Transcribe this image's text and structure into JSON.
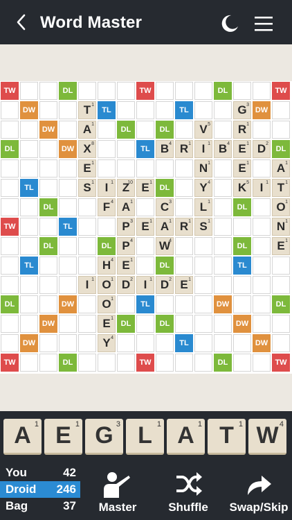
{
  "header": {
    "title": "Word Master",
    "back_icon": "chevron-left-icon",
    "night_icon": "moon-icon",
    "menu_icon": "hamburger-menu-icon"
  },
  "board": {
    "size": 15,
    "premium_labels": {
      "TW": "TW",
      "DW": "DW",
      "TL": "TL",
      "DL": "DL"
    },
    "colors": {
      "TW": "#de4c4c",
      "DW": "#e0913e",
      "TL": "#2a8ad0",
      "DL": "#7db93b",
      "tile": "#e8dfcd"
    },
    "premiums": [
      "TW..DL...TW...DL..TW",
      "x"
    ],
    "premium_grid": [
      [
        "TW",
        "",
        "",
        "DL",
        "",
        "",
        "",
        "TW",
        "",
        "",
        "",
        "DL",
        "",
        "",
        "TW"
      ],
      [
        "",
        "DW",
        "",
        "",
        "",
        "TL",
        "",
        "",
        "",
        "TL",
        "",
        "",
        "",
        "DW",
        ""
      ],
      [
        "",
        "",
        "DW",
        "",
        "",
        "",
        "DL",
        "",
        "DL",
        "",
        "",
        "",
        "DW",
        "",
        ""
      ],
      [
        "DL",
        "",
        "",
        "DW",
        "",
        "",
        "",
        "TL",
        "",
        "",
        "",
        "DW",
        "",
        "",
        "DL"
      ],
      [
        "",
        "",
        "",
        "",
        "DW",
        "",
        "",
        "",
        "",
        "",
        "DW",
        "",
        "",
        "",
        ""
      ],
      [
        "",
        "TL",
        "",
        "",
        "",
        "TL",
        "",
        "",
        "DL",
        "",
        "",
        "",
        "TL",
        "",
        ""
      ],
      [
        "",
        "",
        "DL",
        "",
        "",
        "",
        "DL",
        "",
        "DL",
        "",
        "",
        "",
        "DL",
        "",
        ""
      ],
      [
        "TW",
        "",
        "",
        "TL",
        "",
        "",
        "",
        "",
        "",
        "",
        "TL",
        "",
        "",
        "",
        "TW"
      ],
      [
        "",
        "",
        "DL",
        "",
        "",
        "DL",
        "",
        "",
        "DL",
        "",
        "",
        "",
        "DL",
        "",
        ""
      ],
      [
        "",
        "TL",
        "",
        "",
        "",
        "TL",
        "",
        "",
        "DL",
        "",
        "",
        "",
        "TL",
        "",
        ""
      ],
      [
        "",
        "",
        "",
        "",
        "DW",
        "",
        "",
        "",
        "",
        "DW",
        "",
        "",
        "",
        "",
        ""
      ],
      [
        "DL",
        "",
        "",
        "DW",
        "",
        "",
        "",
        "TL",
        "",
        "",
        "",
        "DW",
        "",
        "",
        "DL"
      ],
      [
        "",
        "",
        "DW",
        "",
        "",
        "",
        "DL",
        "",
        "DL",
        "",
        "",
        "",
        "DW",
        "",
        ""
      ],
      [
        "",
        "DW",
        "",
        "",
        "",
        "",
        "",
        "",
        "",
        "TL",
        "",
        "",
        "",
        "DW",
        ""
      ],
      [
        "TW",
        "",
        "",
        "DL",
        "",
        "",
        "",
        "TW",
        "",
        "",
        "",
        "DL",
        "",
        "",
        "TW"
      ]
    ],
    "tiles": [
      {
        "r": 1,
        "c": 4,
        "letter": "T",
        "points": "1"
      },
      {
        "r": 1,
        "c": 12,
        "letter": "G",
        "points": "3"
      },
      {
        "r": 2,
        "c": 4,
        "letter": "A",
        "points": "1"
      },
      {
        "r": 2,
        "c": 10,
        "letter": "V",
        "points": "5"
      },
      {
        "r": 2,
        "c": 12,
        "letter": "R",
        "points": "1"
      },
      {
        "r": 3,
        "c": 4,
        "letter": "X",
        "points": "8"
      },
      {
        "r": 3,
        "c": 8,
        "letter": "B",
        "points": "4"
      },
      {
        "r": 3,
        "c": 9,
        "letter": "R",
        "points": "1"
      },
      {
        "r": 3,
        "c": 10,
        "letter": "I",
        "points": "1"
      },
      {
        "r": 3,
        "c": 11,
        "letter": "B",
        "points": "4"
      },
      {
        "r": 3,
        "c": 12,
        "letter": "E",
        "points": "1"
      },
      {
        "r": 3,
        "c": 13,
        "letter": "D",
        "points": "2"
      },
      {
        "r": 4,
        "c": 4,
        "letter": "E",
        "points": "1"
      },
      {
        "r": 4,
        "c": 10,
        "letter": "N",
        "points": "1"
      },
      {
        "r": 4,
        "c": 12,
        "letter": "E",
        "points": "1"
      },
      {
        "r": 4,
        "c": 14,
        "letter": "A",
        "points": "1"
      },
      {
        "r": 5,
        "c": 4,
        "letter": "S",
        "points": "1"
      },
      {
        "r": 5,
        "c": 5,
        "letter": "I",
        "points": "1"
      },
      {
        "r": 5,
        "c": 6,
        "letter": "Z",
        "points": "10"
      },
      {
        "r": 5,
        "c": 7,
        "letter": "E",
        "points": "1"
      },
      {
        "r": 5,
        "c": 10,
        "letter": "Y",
        "points": "4"
      },
      {
        "r": 5,
        "c": 12,
        "letter": "K",
        "points": "5"
      },
      {
        "r": 5,
        "c": 13,
        "letter": "I",
        "points": "1"
      },
      {
        "r": 5,
        "c": 14,
        "letter": "T",
        "points": "1"
      },
      {
        "r": 6,
        "c": 5,
        "letter": "F",
        "points": "4"
      },
      {
        "r": 6,
        "c": 6,
        "letter": "A",
        "points": "1"
      },
      {
        "r": 6,
        "c": 8,
        "letter": "C",
        "points": "3"
      },
      {
        "r": 6,
        "c": 10,
        "letter": "L",
        "points": "1"
      },
      {
        "r": 6,
        "c": 14,
        "letter": "O",
        "points": "1"
      },
      {
        "r": 7,
        "c": 6,
        "letter": "P",
        "points": "3"
      },
      {
        "r": 7,
        "c": 7,
        "letter": "E",
        "points": "1"
      },
      {
        "r": 7,
        "c": 8,
        "letter": "A",
        "points": "1"
      },
      {
        "r": 7,
        "c": 9,
        "letter": "R",
        "points": "1"
      },
      {
        "r": 7,
        "c": 10,
        "letter": "S",
        "points": "1"
      },
      {
        "r": 7,
        "c": 14,
        "letter": "N",
        "points": "1"
      },
      {
        "r": 8,
        "c": 6,
        "letter": "P",
        "points": "4"
      },
      {
        "r": 8,
        "c": 8,
        "letter": "W",
        "points": "4"
      },
      {
        "r": 8,
        "c": 14,
        "letter": "E",
        "points": "1"
      },
      {
        "r": 9,
        "c": 5,
        "letter": "H",
        "points": "4"
      },
      {
        "r": 9,
        "c": 6,
        "letter": "E",
        "points": "1"
      },
      {
        "r": 10,
        "c": 4,
        "letter": "I",
        "points": "1"
      },
      {
        "r": 10,
        "c": 5,
        "letter": "O",
        "points": "1"
      },
      {
        "r": 10,
        "c": 6,
        "letter": "D",
        "points": "2"
      },
      {
        "r": 10,
        "c": 7,
        "letter": "I",
        "points": "1"
      },
      {
        "r": 10,
        "c": 8,
        "letter": "D",
        "points": "2"
      },
      {
        "r": 10,
        "c": 9,
        "letter": "E",
        "points": "1"
      },
      {
        "r": 11,
        "c": 5,
        "letter": "O",
        "points": "1"
      },
      {
        "r": 12,
        "c": 5,
        "letter": "E",
        "points": "1"
      },
      {
        "r": 13,
        "c": 5,
        "letter": "Y",
        "points": "4"
      }
    ]
  },
  "rack": [
    {
      "letter": "A",
      "points": "1"
    },
    {
      "letter": "E",
      "points": "1"
    },
    {
      "letter": "G",
      "points": "3"
    },
    {
      "letter": "L",
      "points": "1"
    },
    {
      "letter": "A",
      "points": "1"
    },
    {
      "letter": "T",
      "points": "1"
    },
    {
      "letter": "W",
      "points": "4"
    }
  ],
  "scores": [
    {
      "name": "You",
      "score": "42",
      "active": false
    },
    {
      "name": "Droid",
      "score": "246",
      "active": true
    },
    {
      "name": "Bag",
      "score": "37",
      "active": false
    }
  ],
  "actions": [
    {
      "id": "master",
      "label": "Master",
      "icon": "master-presenter-icon"
    },
    {
      "id": "shuffle",
      "label": "Shuffle",
      "icon": "shuffle-icon"
    },
    {
      "id": "swap",
      "label": "Swap/Skip",
      "icon": "swap-arrow-icon"
    }
  ]
}
